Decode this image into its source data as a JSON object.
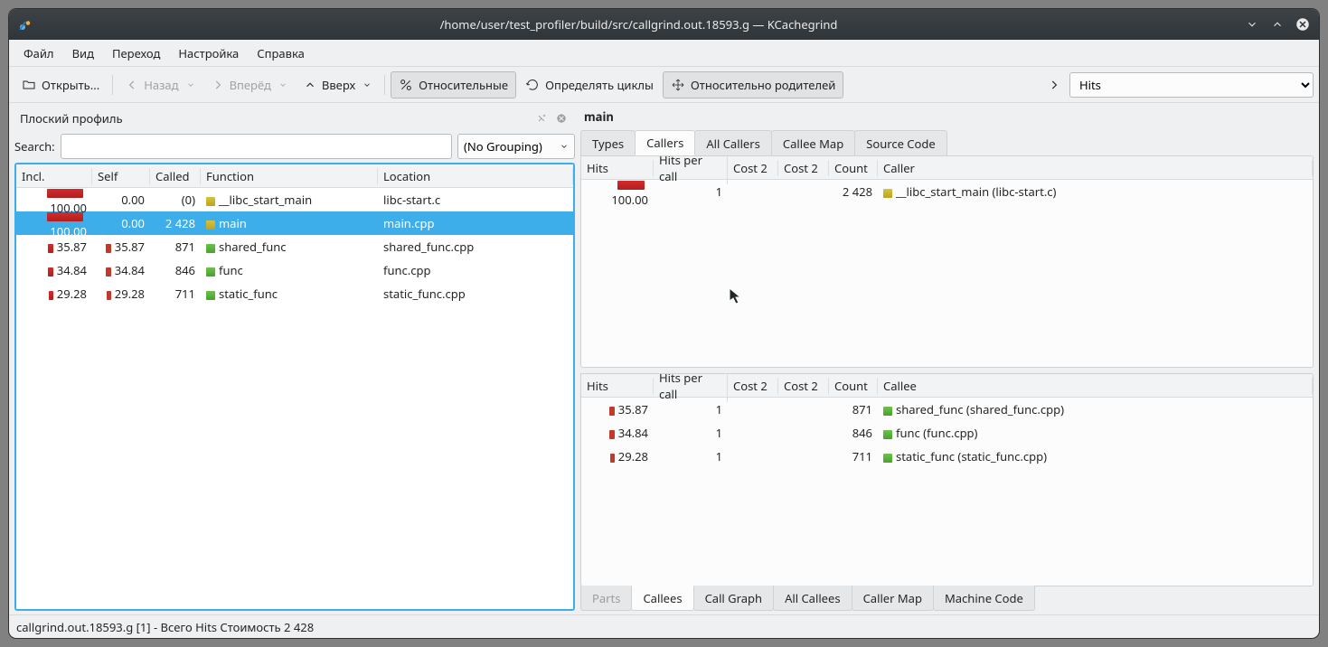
{
  "window": {
    "title": "/home/user/test_profiler/build/src/callgrind.out.18593.g — KCachegrind"
  },
  "menu": {
    "file": "Файл",
    "view": "Вид",
    "go": "Переход",
    "settings": "Настройка",
    "help": "Справка"
  },
  "toolbar": {
    "open": "Открыть...",
    "back": "Назад",
    "forward": "Вперёд",
    "up": "Вверх",
    "relative": "Относительные",
    "detect": "Определять циклы",
    "relparent": "Относительно родителей",
    "event_combo": "Hits"
  },
  "dock": {
    "title": "Плоский профиль"
  },
  "search": {
    "label": "Search:",
    "value": ""
  },
  "grouping": {
    "label": "(No Grouping)"
  },
  "flat": {
    "headers": {
      "incl": "Incl.",
      "self": "Self",
      "called": "Called",
      "func": "Function",
      "loc": "Location"
    },
    "rows": [
      {
        "incl": "100.00",
        "self": "0.00",
        "called": "(0)",
        "func": "__libc_start_main",
        "loc": "libc-start.c",
        "inclBar": 40,
        "selfBar": 0,
        "funcColor": "bar-yellow",
        "selected": false
      },
      {
        "incl": "100.00",
        "self": "0.00",
        "called": "2 428",
        "func": "main",
        "loc": "main.cpp",
        "inclBar": 40,
        "selfBar": 0,
        "funcColor": "bar-yellow",
        "selected": true
      },
      {
        "incl": "35.87",
        "self": "35.87",
        "called": "871",
        "func": "shared_func",
        "loc": "shared_func.cpp",
        "inclBar": 6,
        "selfBar": 6,
        "funcColor": "bar-green",
        "selected": false
      },
      {
        "incl": "34.84",
        "self": "34.84",
        "called": "846",
        "func": "func",
        "loc": "func.cpp",
        "inclBar": 6,
        "selfBar": 6,
        "funcColor": "bar-green",
        "selected": false
      },
      {
        "incl": "29.28",
        "self": "29.28",
        "called": "711",
        "func": "static_func",
        "loc": "static_func.cpp",
        "inclBar": 5,
        "selfBar": 5,
        "funcColor": "bar-green",
        "selected": false
      }
    ]
  },
  "selected_function": "main",
  "tabs_top": {
    "types": "Types",
    "callers": "Callers",
    "all_callers": "All Callers",
    "callee_map": "Callee Map",
    "source": "Source Code"
  },
  "callers": {
    "headers": {
      "hits": "Hits",
      "hpc": "Hits per call",
      "c2a": "Cost 2",
      "c2b": "Cost 2",
      "count": "Count",
      "caller": "Caller"
    },
    "rows": [
      {
        "hits": "100.00",
        "hpc": "1",
        "c2a": "",
        "c2b": "",
        "count": "2 428",
        "name": "__libc_start_main (libc-start.c)",
        "hitsBar": 30,
        "color": "bar-yellow"
      }
    ]
  },
  "callees": {
    "headers": {
      "hits": "Hits",
      "hpc": "Hits per call",
      "c2a": "Cost 2",
      "c2b": "Cost 2",
      "count": "Count",
      "callee": "Callee"
    },
    "rows": [
      {
        "hits": "35.87",
        "hpc": "1",
        "c2a": "",
        "c2b": "",
        "count": "871",
        "name": "shared_func (shared_func.cpp)",
        "hitsBar": 6,
        "color": "bar-green"
      },
      {
        "hits": "34.84",
        "hpc": "1",
        "c2a": "",
        "c2b": "",
        "count": "846",
        "name": "func (func.cpp)",
        "hitsBar": 6,
        "color": "bar-green"
      },
      {
        "hits": "29.28",
        "hpc": "1",
        "c2a": "",
        "c2b": "",
        "count": "711",
        "name": "static_func (static_func.cpp)",
        "hitsBar": 5,
        "color": "bar-green"
      }
    ]
  },
  "tabs_bot": {
    "parts": "Parts",
    "callees": "Callees",
    "call_graph": "Call Graph",
    "all_callees": "All Callees",
    "caller_map": "Caller Map",
    "machine": "Machine Code"
  },
  "status": "callgrind.out.18593.g [1] - Всего Hits Стоимость 2 428"
}
